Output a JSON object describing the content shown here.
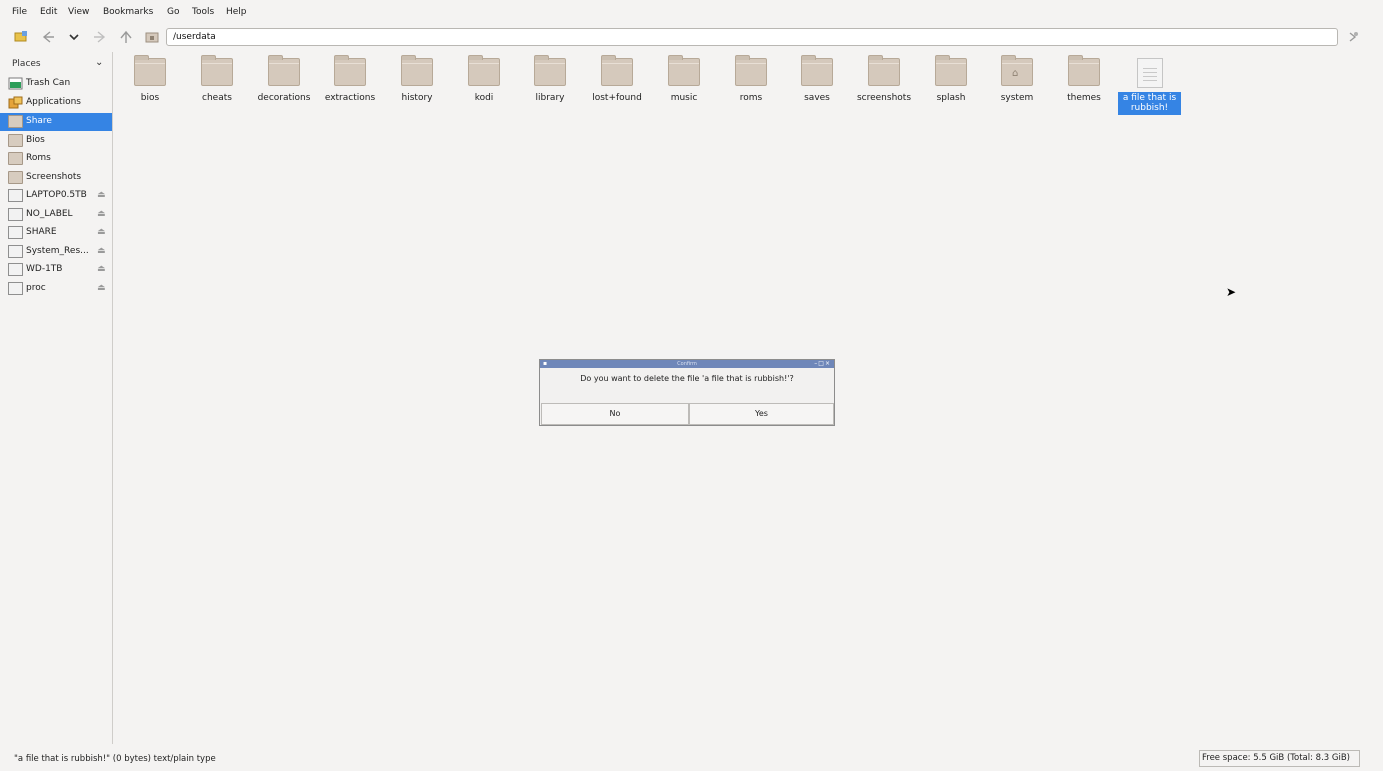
{
  "menu": [
    "File",
    "Edit",
    "View",
    "Bookmarks",
    "Go",
    "Tools",
    "Help"
  ],
  "toolbar": {
    "path": "/userdata"
  },
  "sidebar": {
    "header": "Places",
    "items": [
      {
        "label": "Trash Can",
        "icon": "trash-icon"
      },
      {
        "label": "Applications",
        "icon": "applications-icon"
      },
      {
        "label": "Share",
        "icon": "folder-icon",
        "selected": true
      },
      {
        "label": "Bios",
        "icon": "folder-icon"
      },
      {
        "label": "Roms",
        "icon": "folder-icon"
      },
      {
        "label": "Screenshots",
        "icon": "folder-icon"
      },
      {
        "label": "LAPTOP0.5TB",
        "icon": "drive-icon",
        "eject": true
      },
      {
        "label": "NO_LABEL",
        "icon": "drive-icon",
        "eject": true
      },
      {
        "label": "SHARE",
        "icon": "drive-icon",
        "eject": true
      },
      {
        "label": "System_Res...",
        "icon": "drive-icon",
        "eject": true
      },
      {
        "label": "WD-1TB",
        "icon": "drive-icon",
        "eject": true
      },
      {
        "label": "proc",
        "icon": "drive-icon",
        "eject": true
      }
    ]
  },
  "files": [
    {
      "name": "bios",
      "type": "folder"
    },
    {
      "name": "cheats",
      "type": "folder"
    },
    {
      "name": "decorations",
      "type": "folder"
    },
    {
      "name": "extractions",
      "type": "folder"
    },
    {
      "name": "history",
      "type": "folder"
    },
    {
      "name": "kodi",
      "type": "folder"
    },
    {
      "name": "library",
      "type": "folder"
    },
    {
      "name": "lost+found",
      "type": "folder"
    },
    {
      "name": "music",
      "type": "folder"
    },
    {
      "name": "roms",
      "type": "folder"
    },
    {
      "name": "saves",
      "type": "folder"
    },
    {
      "name": "screenshots",
      "type": "folder"
    },
    {
      "name": "splash",
      "type": "folder"
    },
    {
      "name": "system",
      "type": "folder-home"
    },
    {
      "name": "themes",
      "type": "folder"
    },
    {
      "name": "a file that is rubbish!",
      "type": "text-file",
      "selected": true
    }
  ],
  "dialog": {
    "title": "Confirm",
    "message": "Do you want to delete the file 'a file that is rubbish!'?",
    "no_label": "No",
    "yes_label": "Yes"
  },
  "status": {
    "left": "\"a file that is rubbish!\" (0 bytes) text/plain type",
    "right": "Free space: 5.5 GiB (Total: 8.3 GiB)"
  },
  "colors": {
    "selection": "#3584e4",
    "dialog_titlebar": "#6f87b9"
  }
}
